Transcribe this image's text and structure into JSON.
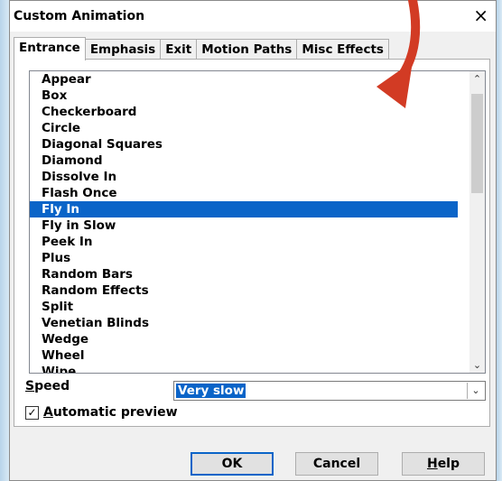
{
  "dialog": {
    "title": "Custom Animation",
    "close_glyph": "×"
  },
  "tabs": [
    {
      "label": "Entrance",
      "active": true
    },
    {
      "label": "Emphasis",
      "active": false
    },
    {
      "label": "Exit",
      "active": false
    },
    {
      "label": "Motion Paths",
      "active": false
    },
    {
      "label": "Misc Effects",
      "active": false
    }
  ],
  "effects": {
    "items": [
      "Appear",
      "Box",
      "Checkerboard",
      "Circle",
      "Diagonal Squares",
      "Diamond",
      "Dissolve In",
      "Flash Once",
      "Fly In",
      "Fly in Slow",
      "Peek In",
      "Plus",
      "Random Bars",
      "Random Effects",
      "Split",
      "Venetian Blinds",
      "Wedge",
      "Wheel",
      "Wipe"
    ],
    "selected": "Fly In"
  },
  "speed": {
    "label_mnemonic": "S",
    "label_rest": "peed",
    "value": "Very slow"
  },
  "auto_preview": {
    "checked": true,
    "check_glyph": "✓",
    "label_mnemonic": "A",
    "label_rest": "utomatic preview"
  },
  "buttons": {
    "ok": "OK",
    "cancel": "Cancel",
    "help_mnemonic": "H",
    "help_rest": "elp"
  },
  "icons": {
    "scroll_up": "⌃",
    "scroll_down": "⌄",
    "dropdown": "⌄"
  },
  "colors": {
    "selection": "#0a64c8",
    "annotation_arrow": "#d23b24"
  }
}
